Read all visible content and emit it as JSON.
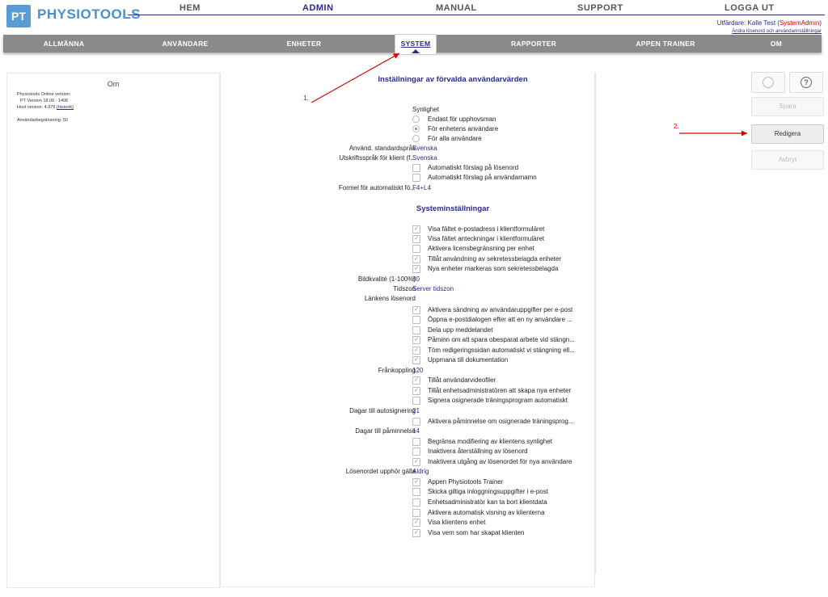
{
  "logo": {
    "mark": "PT",
    "name": "PHYSIOTOOLS"
  },
  "topnav": [
    "HEM",
    "ADMIN",
    "MANUAL",
    "SUPPORT",
    "LOGGA UT"
  ],
  "user": {
    "prefix": "Utfärdare: Kalle Test (",
    "role": "SystemAdmin",
    "suffix": ")",
    "sub": "Ändra lösenord och användarinställningar"
  },
  "menu": [
    "ALLMÄNNA",
    "ANVÄNDARE",
    "ENHETER",
    "SYSTEM",
    "RAPPORTER",
    "APPEN TRAINER",
    "OM"
  ],
  "om": {
    "title": "Om",
    "line1": "Physiotools Online version:",
    "line2": "PT Version 18.00 - 1406",
    "line3": "Host version: 4.976",
    "history": "(historik)",
    "line4": "Användarbegränsning: 50"
  },
  "section1": {
    "title": "Inställningar av förvalda användarvärden",
    "visibility_label": "Synlighet",
    "visibility_options": [
      "Endast för upphovsman",
      "För enhetens användare",
      "För alla användare"
    ],
    "lang_label": "Använd. standardspråk",
    "lang_value": "Svenska",
    "print_label": "Utskriftsspråk för klient (f...",
    "print_value": "Svenska",
    "auto_pw": "Automatiskt förslag på lösenord",
    "auto_user": "Automatiskt förslag på användarnamn",
    "formula_label": "Formel för automatiskt fö...",
    "formula_value": "F4+L4"
  },
  "section2": {
    "title": "Systeminställningar",
    "checks1": [
      "Visa fältet e-postadress i klientformuläret",
      "Visa fältet anteckningar i klientformuläret",
      "Aktivera licensbegränsning per enhet",
      "Tillåt användning av sekretessbelagda enheter",
      "Nya enheter markeras som sekretessbelagda"
    ],
    "quality_label": "Bildkvalité (1-100%)",
    "quality_value": "80",
    "tz_label": "Tidszon",
    "tz_value": "Server tidszon",
    "link_label": "Länkens lösenord",
    "checks2": [
      "Aktivera sändning av användaruppgifter per e-post",
      "Öppna e-postdialogen efter att en ny användare ...",
      "Dela upp meddelandet",
      "Påminn om att spara obesparat arbete vid stängn...",
      "Töm redigeringssidan automatiskt vi stängning ell...",
      "Uppmana till dokumentation"
    ],
    "disconnect_label": "Frånkoppling",
    "disconnect_value": "120",
    "checks3": [
      "Tillåt användarvideofiler",
      "Tillåt enhetsadministratören att skapa nya enheter",
      "Signera osignerade träningsprogram automatiskt"
    ],
    "autosign_label": "Dagar till autosignering",
    "autosign_value": "21",
    "check4": "Aktivera påminnelse om osignerade träningsprog...",
    "reminder_label": "Dagar till påminnelse",
    "reminder_value": "14",
    "checks5": [
      "Begränsa modifiering av klientens synlighet",
      "Inaktivera återställning av lösenord",
      "Inaktivera utgång av lösenordet för nya användare"
    ],
    "expire_label": "Lösenordet upphör gälla",
    "expire_value": "Aldrig",
    "checks6": [
      "Appen Physiotools Trainer",
      "Skicka giltiga inloggningsuppgifter i e-post",
      "Enhetsadministratör kan ta bort klientdata",
      "Aktivera automatisk visning av klienterna",
      "Visa klientens enhet",
      "Visa vem som har skapat klienten"
    ]
  },
  "buttons": {
    "save": "Spara",
    "edit": "Redigera",
    "cancel": "Avbryt",
    "help": "?"
  },
  "annotations": {
    "a1": "1.",
    "a2": "2."
  },
  "colors": {
    "accent": "#2b2b8c",
    "brand": "#4a90c8",
    "menu_bg": "#8a8a8a",
    "annotation": "#dd0000"
  }
}
